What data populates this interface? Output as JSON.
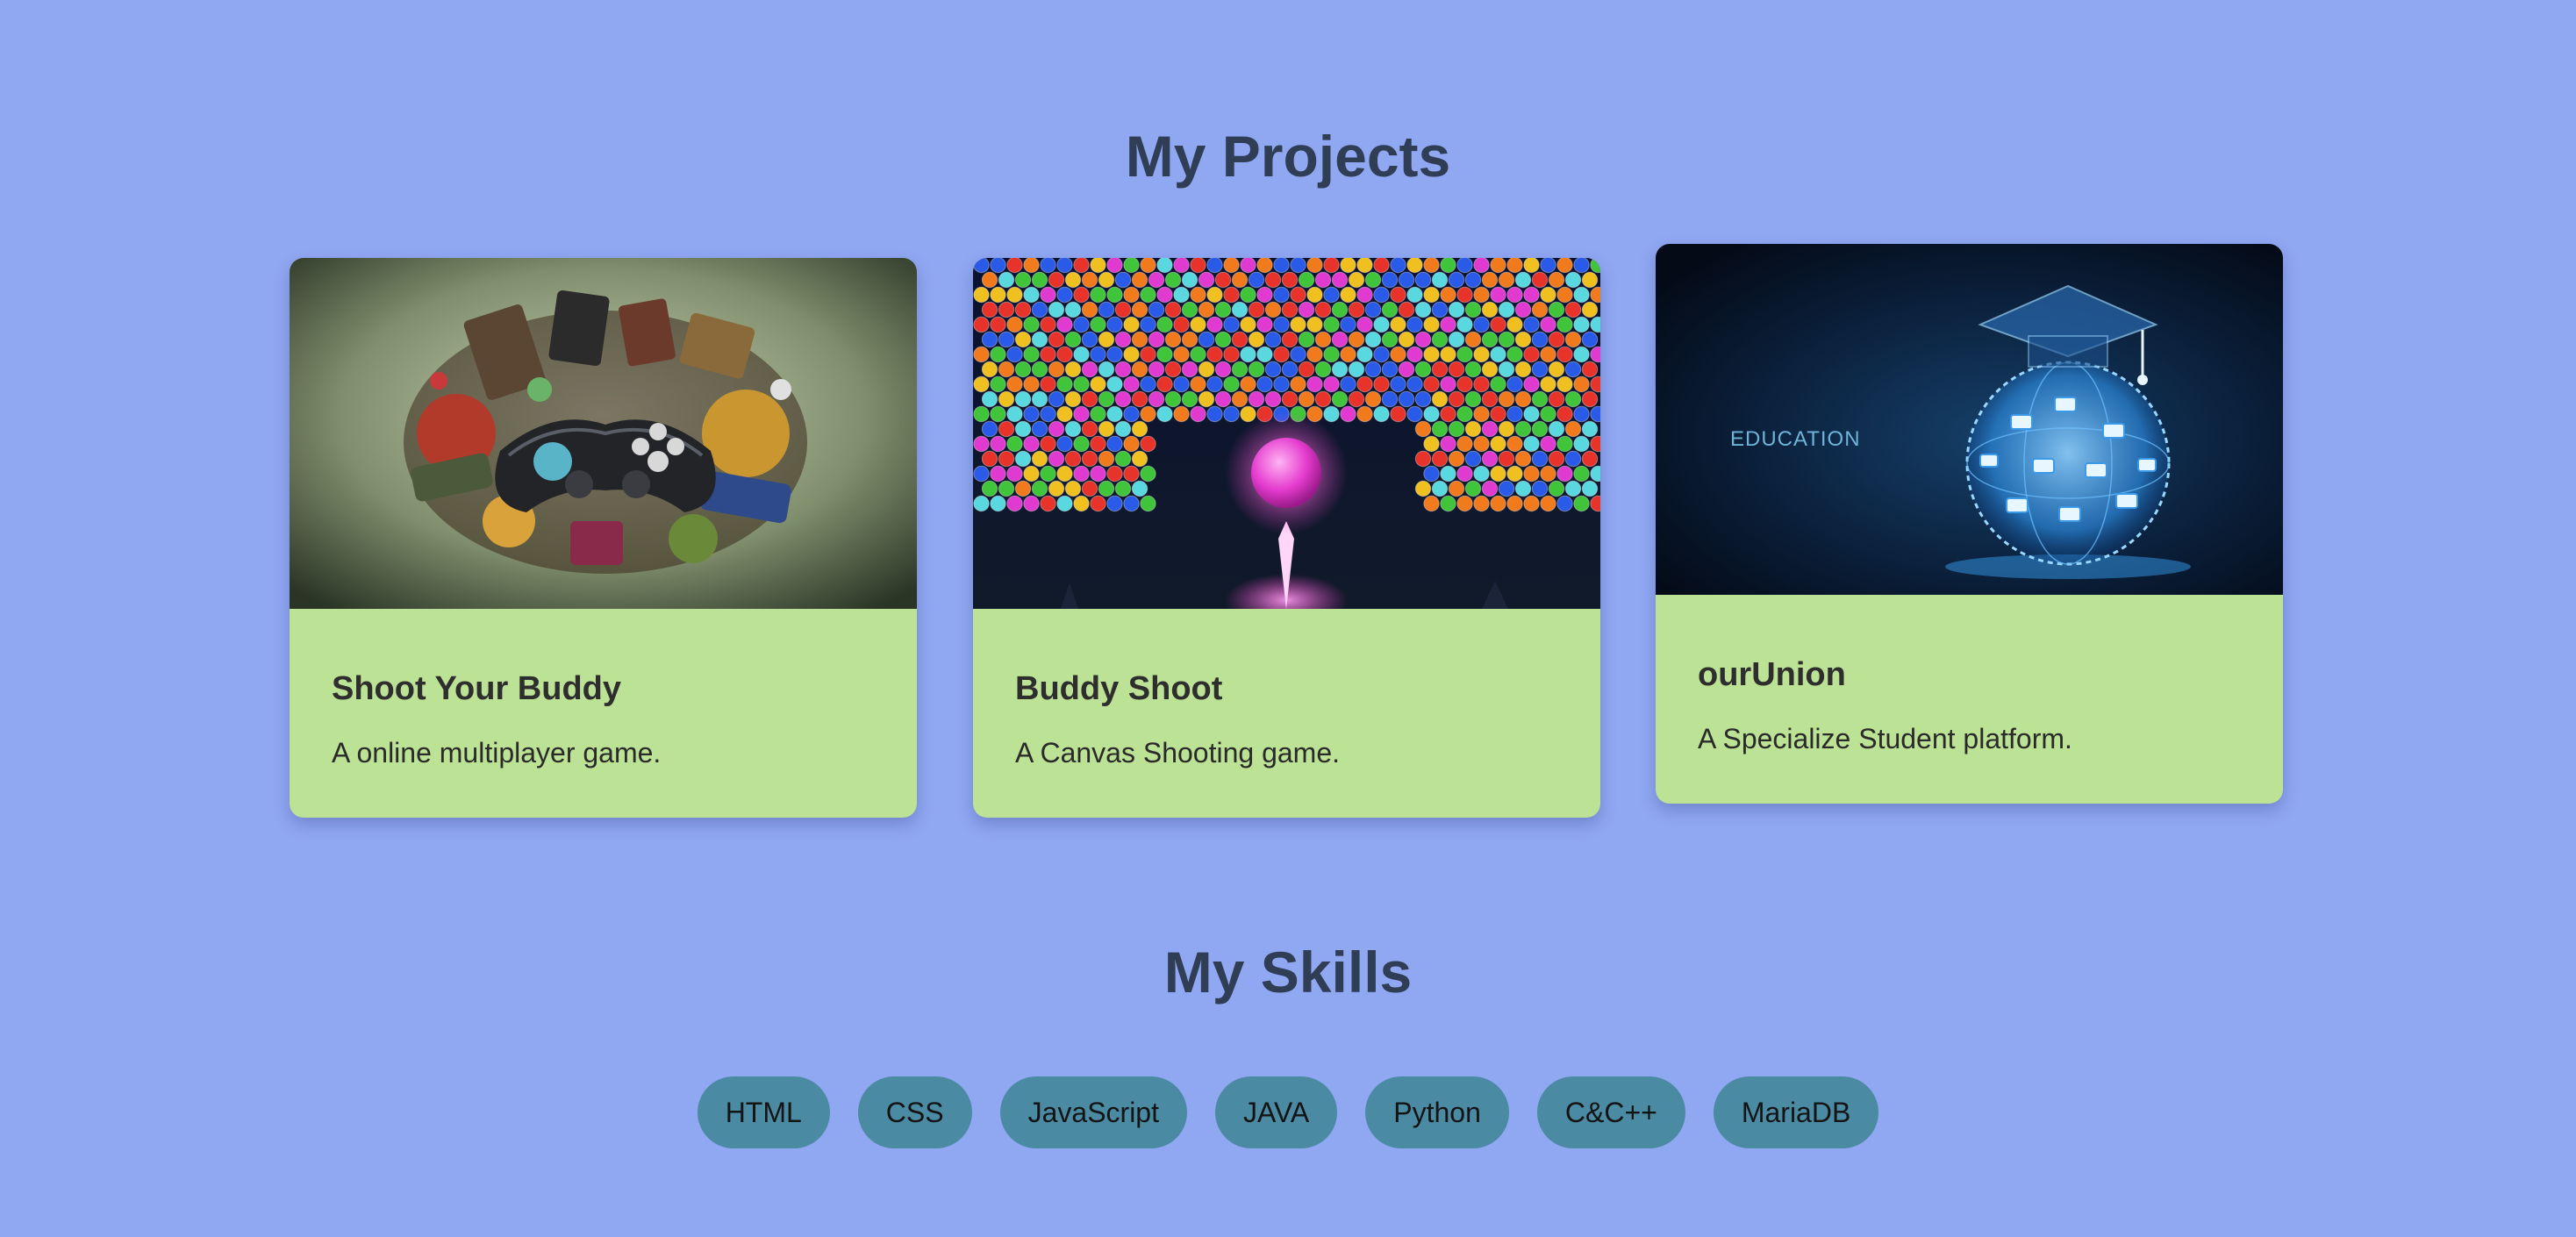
{
  "projects": {
    "title": "My Projects",
    "items": [
      {
        "title": "Shoot Your Buddy",
        "description": "A online multiplayer game."
      },
      {
        "title": "Buddy Shoot",
        "description": "A Canvas Shooting game."
      },
      {
        "title": "ourUnion",
        "description": "A Specialize Student platform.",
        "image_text": "EDUCATION"
      }
    ]
  },
  "skills": {
    "title": "My Skills",
    "items": [
      "HTML",
      "CSS",
      "JavaScript",
      "JAVA",
      "Python",
      "C&C++",
      "MariaDB"
    ]
  },
  "colors": {
    "background": "#90a7f2",
    "card": "#bce295",
    "pill": "#4b8aa3",
    "heading": "#2f3d55"
  }
}
